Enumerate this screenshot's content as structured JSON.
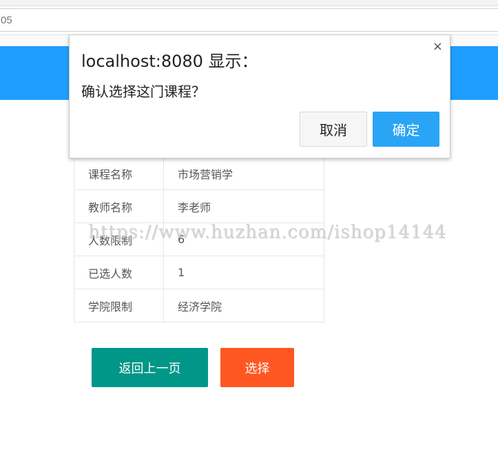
{
  "browser": {
    "address_text": "05"
  },
  "dialog": {
    "title": "localhost:8080 显示：",
    "message": "确认选择这门课程？",
    "close_glyph": "×",
    "cancel_label": "取消",
    "ok_label": "确定"
  },
  "course_table": {
    "rows": [
      {
        "label": "课程名称",
        "value": "市场营销学"
      },
      {
        "label": "教师名称",
        "value": "李老师"
      },
      {
        "label": "人数限制",
        "value": "6"
      },
      {
        "label": "已选人数",
        "value": "1"
      },
      {
        "label": "学院限制",
        "value": "经济学院"
      }
    ]
  },
  "actions": {
    "back_label": "返回上一页",
    "select_label": "选择"
  },
  "watermark": "https://www.huzhan.com/ishop14144",
  "colors": {
    "header": "#1e9fff",
    "back_button": "#009688",
    "select_button": "#ff5722",
    "dialog_ok": "#2aa4f5"
  }
}
